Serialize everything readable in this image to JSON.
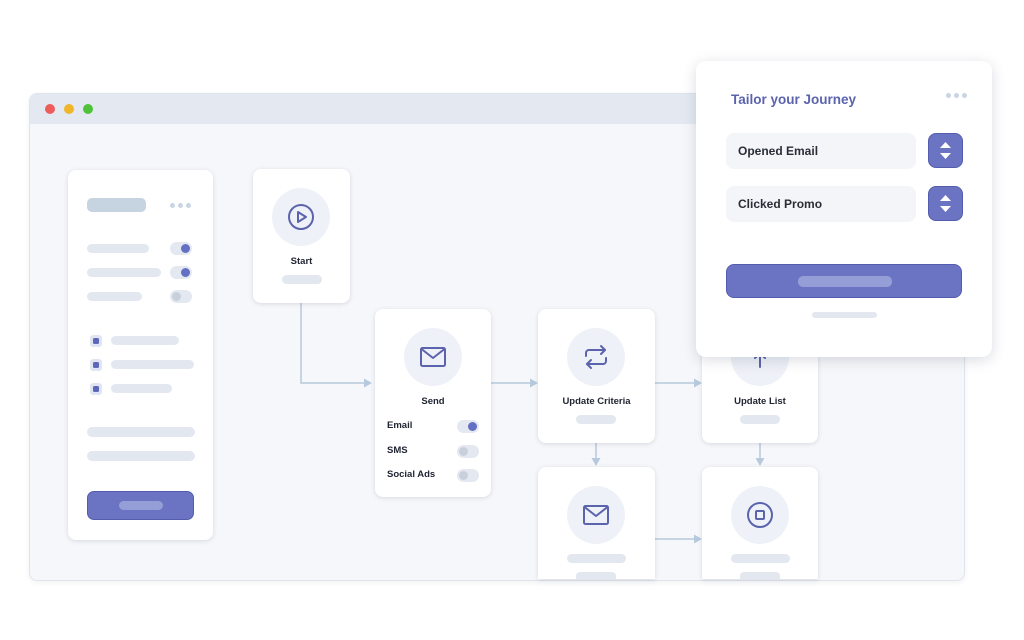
{
  "flow": {
    "start": {
      "label": "Start"
    },
    "send": {
      "label": "Send",
      "channels": [
        {
          "label": "Email",
          "enabled": true
        },
        {
          "label": "SMS",
          "enabled": false
        },
        {
          "label": "Social Ads",
          "enabled": false
        }
      ]
    },
    "update_criteria": {
      "label": "Update Criteria"
    },
    "update_list": {
      "label": "Update List"
    }
  },
  "settings_card": {
    "toggles": [
      true,
      true,
      false
    ],
    "checkboxes": [
      true,
      true,
      true
    ]
  },
  "tailor_panel": {
    "title": "Tailor your Journey",
    "options": [
      {
        "label": "Opened Email"
      },
      {
        "label": "Clicked Promo"
      }
    ]
  },
  "colors": {
    "accent": "#6b74c2",
    "title": "#5b63ad",
    "icon": "#5b63ad",
    "connector": "#b7c9dd",
    "window_bg": "#f6f7fa",
    "titlebar": "#e4e9f1"
  },
  "icons": {
    "start": "play-circle-icon",
    "send": "envelope-icon",
    "update_criteria": "repeat-arrows-icon",
    "update_list": "upload-icon",
    "send_2": "envelope-icon",
    "end": "stop-circle-icon"
  }
}
